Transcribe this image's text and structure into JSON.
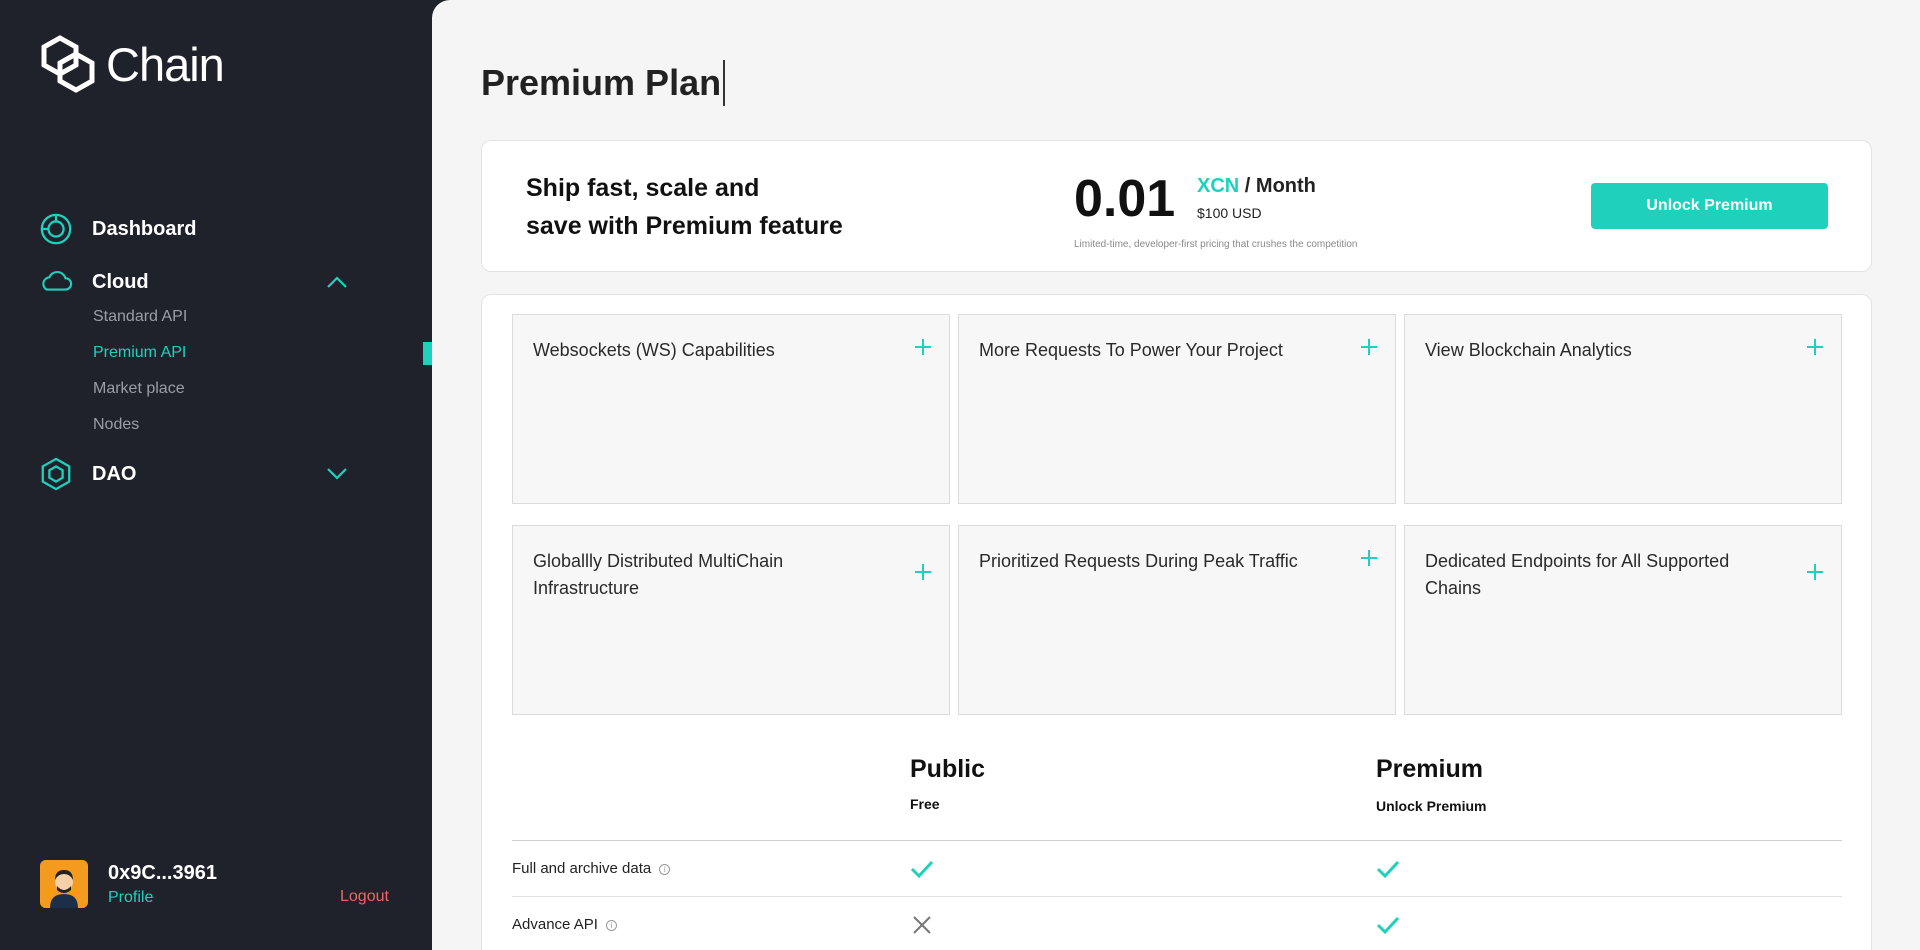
{
  "sidebar": {
    "logo_text": "Chain",
    "nav": {
      "dashboard": "Dashboard",
      "cloud": "Cloud",
      "dao": "DAO"
    },
    "cloud_items": [
      "Standard API",
      "Premium API",
      "Market place",
      "Nodes"
    ],
    "active_item": "Premium API",
    "user": {
      "address": "0x9C...3961",
      "profile_label": "Profile",
      "logout_label": "Logout"
    }
  },
  "main": {
    "title": "Premium Plan",
    "promo": {
      "line1": "Ship fast, scale and",
      "line2": "save with Premium feature",
      "price": "0.01",
      "currency": "XCN",
      "period": " / Month",
      "usd": "$100 USD",
      "note": "Limited-time, developer-first pricing that crushes the competition",
      "button": "Unlock Premium"
    },
    "features": [
      "Websockets (WS) Capabilities",
      "More Requests To Power Your Project",
      "View Blockchain Analytics",
      "Globallly Distributed MultiChain Infrastructure",
      "Prioritized Requests During Peak Traffic",
      "Dedicated Endpoints for All Supported Chains"
    ],
    "comparison": {
      "public": {
        "name": "Public",
        "sub": "Free"
      },
      "premium": {
        "name": "Premium",
        "sub": "Unlock Premium"
      },
      "rows": [
        {
          "label": "Full and archive data",
          "info": "i",
          "public": "check",
          "premium": "check"
        },
        {
          "label": "Advance API",
          "info": "i",
          "public": "cross",
          "premium": "check"
        }
      ]
    }
  },
  "colors": {
    "accent": "#1fd1bd",
    "sidebar_bg": "#1f222b",
    "logout": "#f26464"
  }
}
